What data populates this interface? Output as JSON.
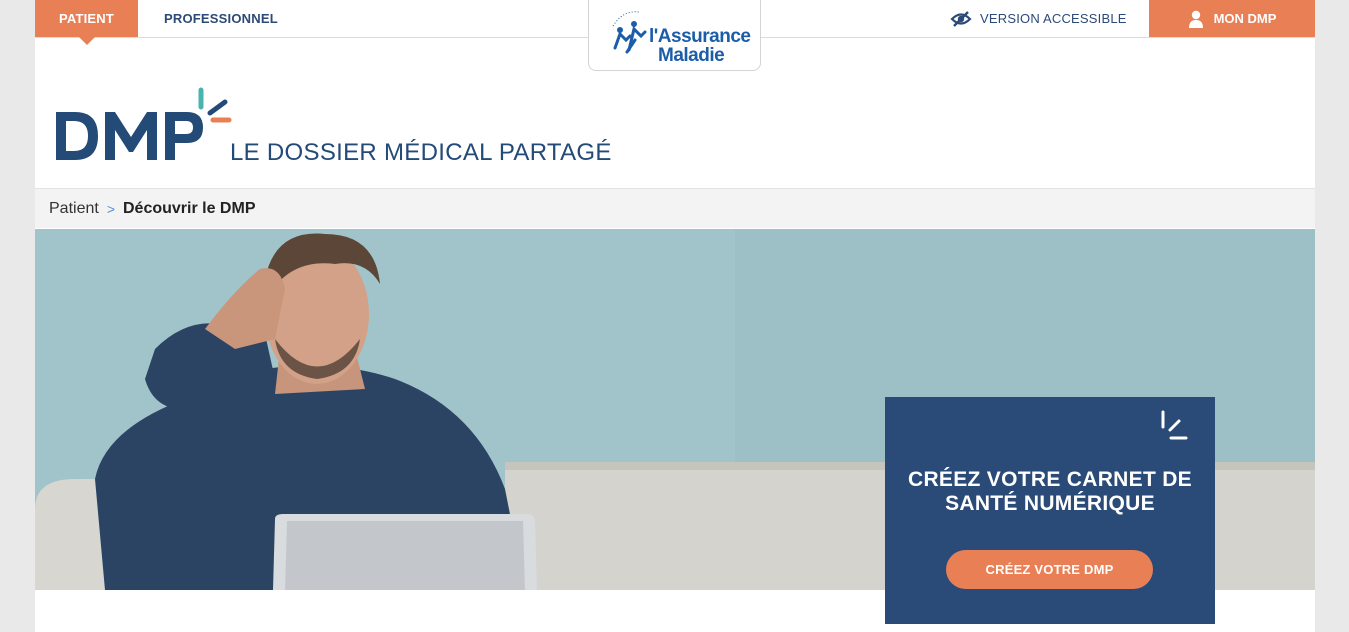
{
  "topbar": {
    "tab_patient": "PATIENT",
    "tab_professionnel": "PROFESSIONNEL",
    "logo_line1": "l'Assurance",
    "logo_line2": "Maladie",
    "accessible_label": "VERSION ACCESSIBLE",
    "mon_dmp_label": "MON DMP"
  },
  "brand": {
    "logo_text": "DMP",
    "tagline": "LE DOSSIER MÉDICAL PARTAGÉ"
  },
  "breadcrumb": {
    "root": "Patient",
    "separator": ">",
    "current": "Découvrir le DMP"
  },
  "hero": {
    "cta_title": "CRÉEZ VOTRE CARNET DE SANTÉ NUMÉRIQUE",
    "cta_button": "CRÉEZ VOTRE DMP"
  },
  "colors": {
    "accent_orange": "#e97f55",
    "brand_navy": "#2a4a78",
    "teal": "#49b3b1"
  },
  "icons": [
    "eye-slash-icon",
    "user-icon",
    "dmp-spark-icon"
  ]
}
